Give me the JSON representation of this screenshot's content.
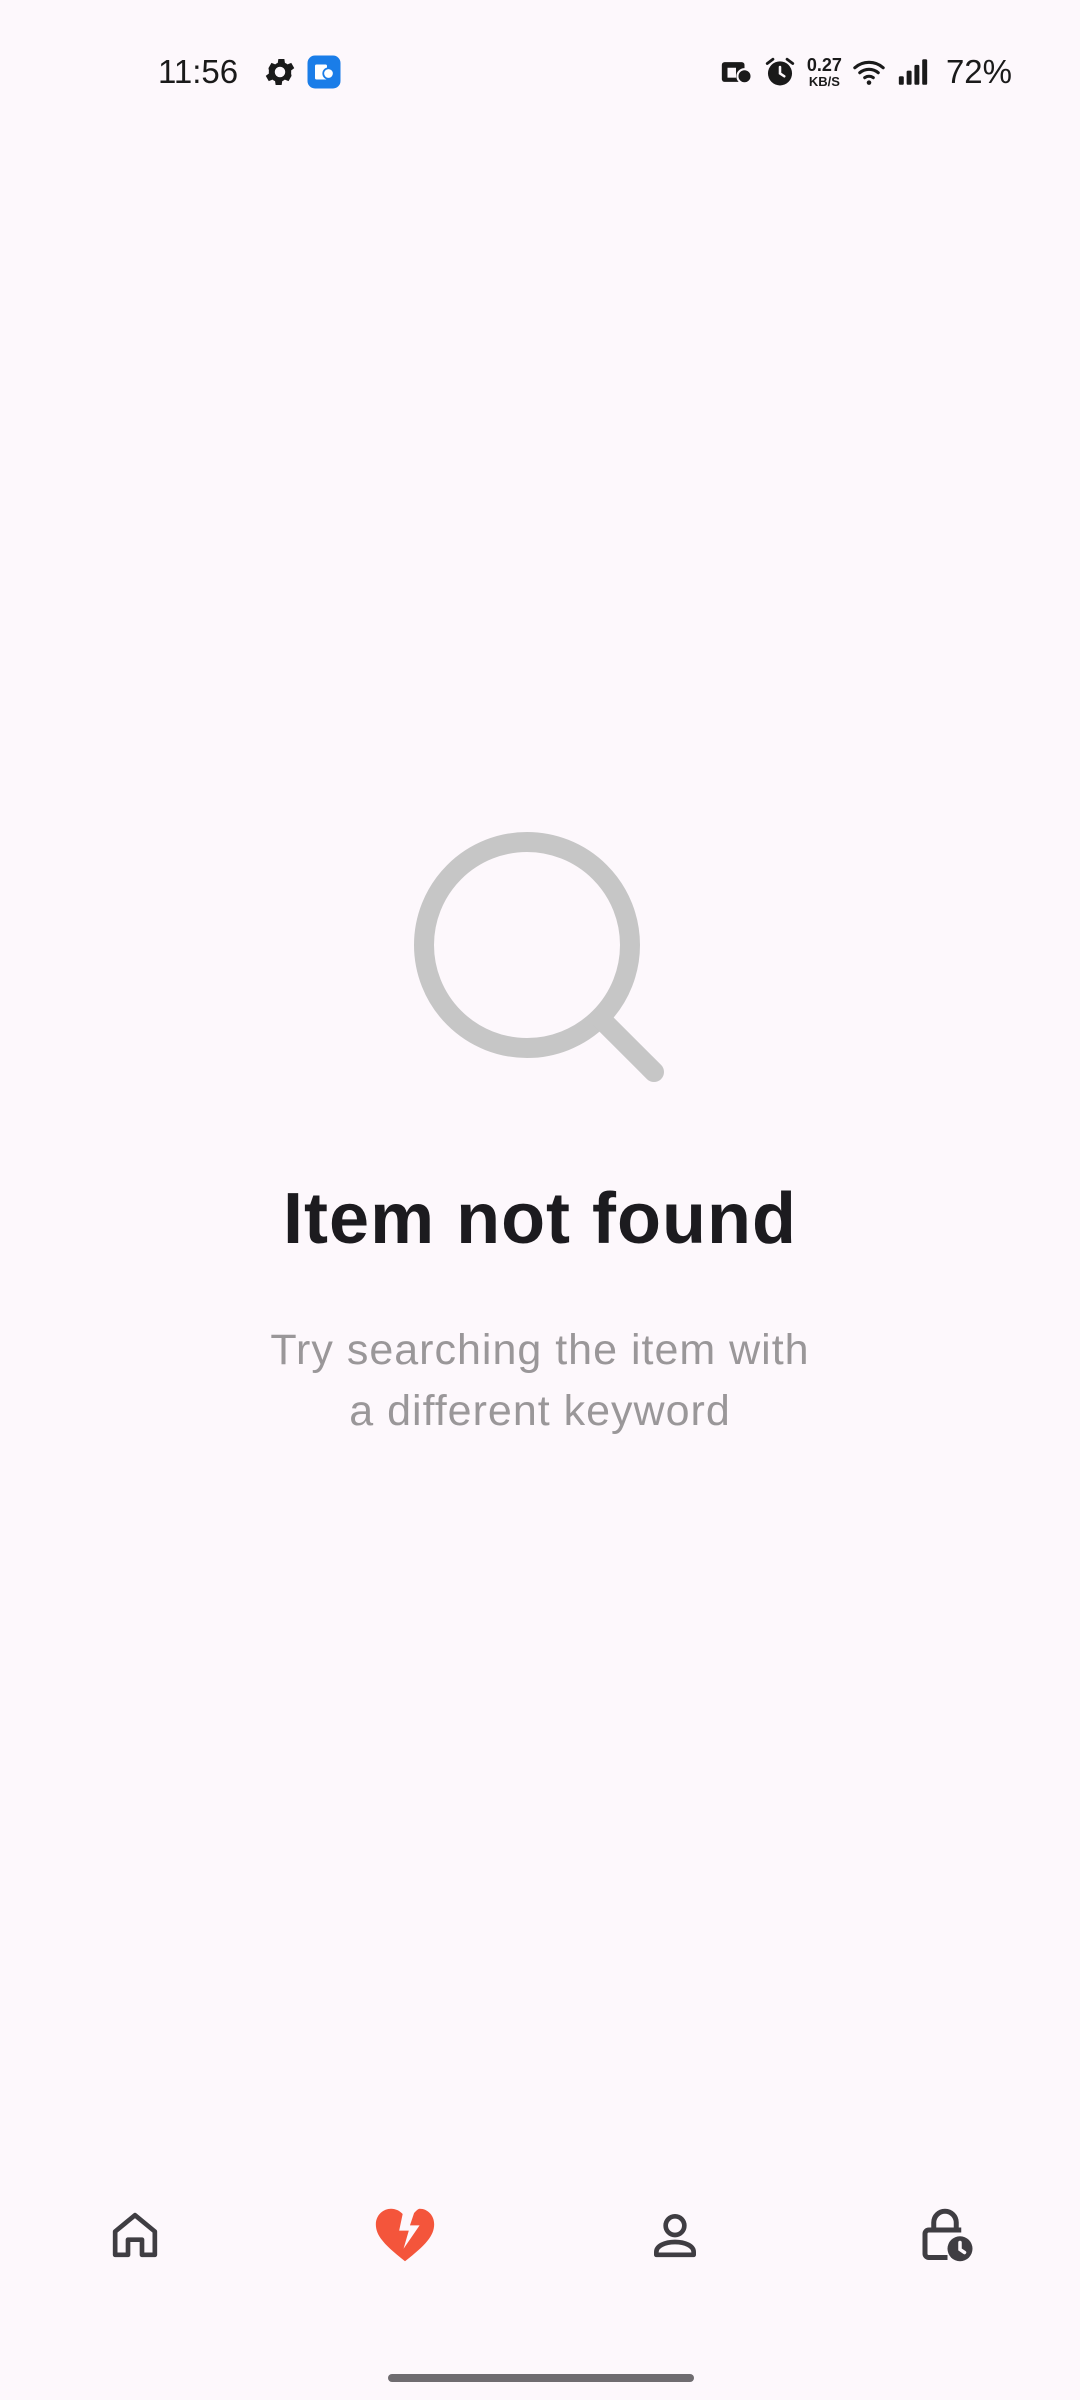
{
  "status_bar": {
    "time": "11:56",
    "left_icons": [
      "settings-gear-icon",
      "app-notification-icon"
    ],
    "right_icons": [
      "nfc-icon",
      "alarm-icon",
      "wifi-icon",
      "signal-icon"
    ],
    "net_speed_value": "0.27",
    "net_speed_unit": "KB/S",
    "battery": "72%"
  },
  "empty_state": {
    "icon": "search-icon",
    "title": "Item not found",
    "subtitle_line1": "Try searching the item with",
    "subtitle_line2": "a different keyword"
  },
  "bottom_nav": {
    "items": [
      {
        "icon": "home-icon",
        "active": false
      },
      {
        "icon": "broken-heart-icon",
        "active": true
      },
      {
        "icon": "profile-icon",
        "active": false
      },
      {
        "icon": "lock-clock-icon",
        "active": false
      }
    ]
  },
  "colors": {
    "background": "#fdf8fc",
    "title": "#1c1b1f",
    "subtitle": "#9a9799",
    "icon_inactive": "#3f3d42",
    "icon_active": "#f4553b",
    "empty_icon": "#c6c6c6",
    "notification_badge": "#1a7de8"
  }
}
